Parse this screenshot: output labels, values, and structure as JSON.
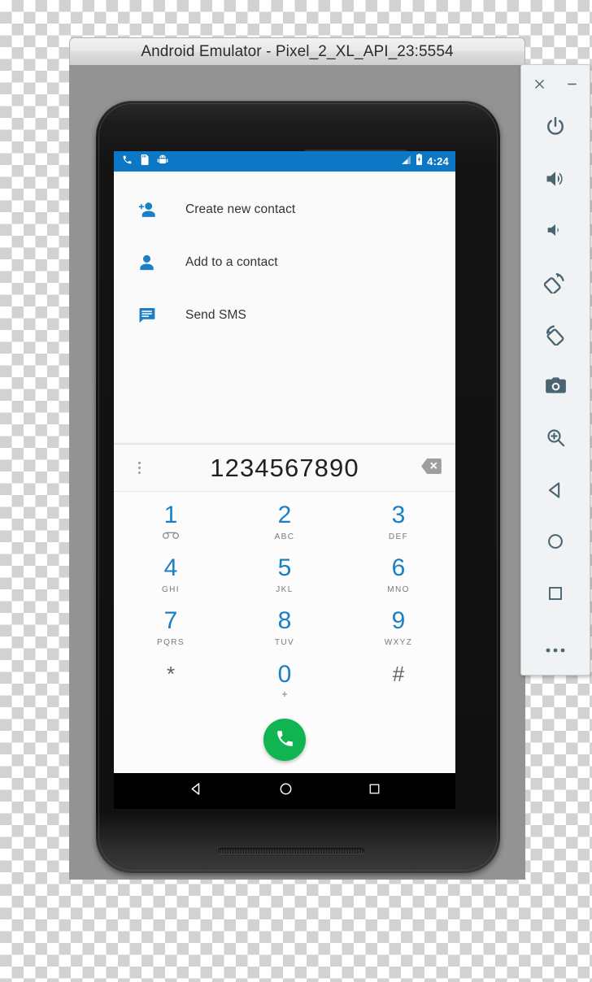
{
  "window": {
    "title": "Android Emulator - Pixel_2_XL_API_23:5554"
  },
  "status_bar": {
    "icons_left": [
      "phone-call-icon",
      "sd-card-icon",
      "android-bug-icon"
    ],
    "icons_right": [
      "signal-bars-icon",
      "battery-charging-icon"
    ],
    "clock": "4:24"
  },
  "actions": [
    {
      "label": "Create new contact",
      "icon": "person-add-icon"
    },
    {
      "label": "Add to a contact",
      "icon": "person-icon"
    },
    {
      "label": "Send SMS",
      "icon": "message-icon"
    }
  ],
  "dialer": {
    "number": "1234567890",
    "overflow_icon": "overflow-menu-icon",
    "backspace_icon": "backspace-icon",
    "call_icon": "phone-call-icon",
    "keys": [
      {
        "digit": "1",
        "sub": "",
        "sub_icon": "voicemail-icon",
        "style": "blue"
      },
      {
        "digit": "2",
        "sub": "ABC",
        "style": "blue"
      },
      {
        "digit": "3",
        "sub": "DEF",
        "style": "blue"
      },
      {
        "digit": "4",
        "sub": "GHI",
        "style": "blue"
      },
      {
        "digit": "5",
        "sub": "JKL",
        "style": "blue"
      },
      {
        "digit": "6",
        "sub": "MNO",
        "style": "blue"
      },
      {
        "digit": "7",
        "sub": "PQRS",
        "style": "blue"
      },
      {
        "digit": "8",
        "sub": "TUV",
        "style": "blue"
      },
      {
        "digit": "9",
        "sub": "WXYZ",
        "style": "blue"
      },
      {
        "digit": "*",
        "sub": "",
        "style": "gray"
      },
      {
        "digit": "0",
        "sub": "+",
        "style": "blue"
      },
      {
        "digit": "#",
        "sub": "",
        "style": "gray"
      }
    ]
  },
  "nav_bar": {
    "back": "back-triangle-icon",
    "home": "home-circle-icon",
    "recents": "recents-square-icon"
  },
  "emulator_toolbar": {
    "close": "close-icon",
    "minimize": "minimize-icon",
    "buttons": [
      {
        "name": "power-icon"
      },
      {
        "name": "volume-up-icon"
      },
      {
        "name": "volume-down-icon"
      },
      {
        "name": "rotate-left-icon"
      },
      {
        "name": "rotate-right-icon"
      },
      {
        "name": "screenshot-camera-icon"
      },
      {
        "name": "zoom-icon"
      },
      {
        "name": "back-triangle-icon"
      },
      {
        "name": "home-circle-icon"
      },
      {
        "name": "recents-square-icon"
      },
      {
        "name": "more-icon"
      }
    ]
  },
  "colors": {
    "status_bar": "#0c77c4",
    "accent_blue": "#1a7fc4",
    "call_green": "#10b551",
    "toolbar_icon": "#4a6572"
  }
}
